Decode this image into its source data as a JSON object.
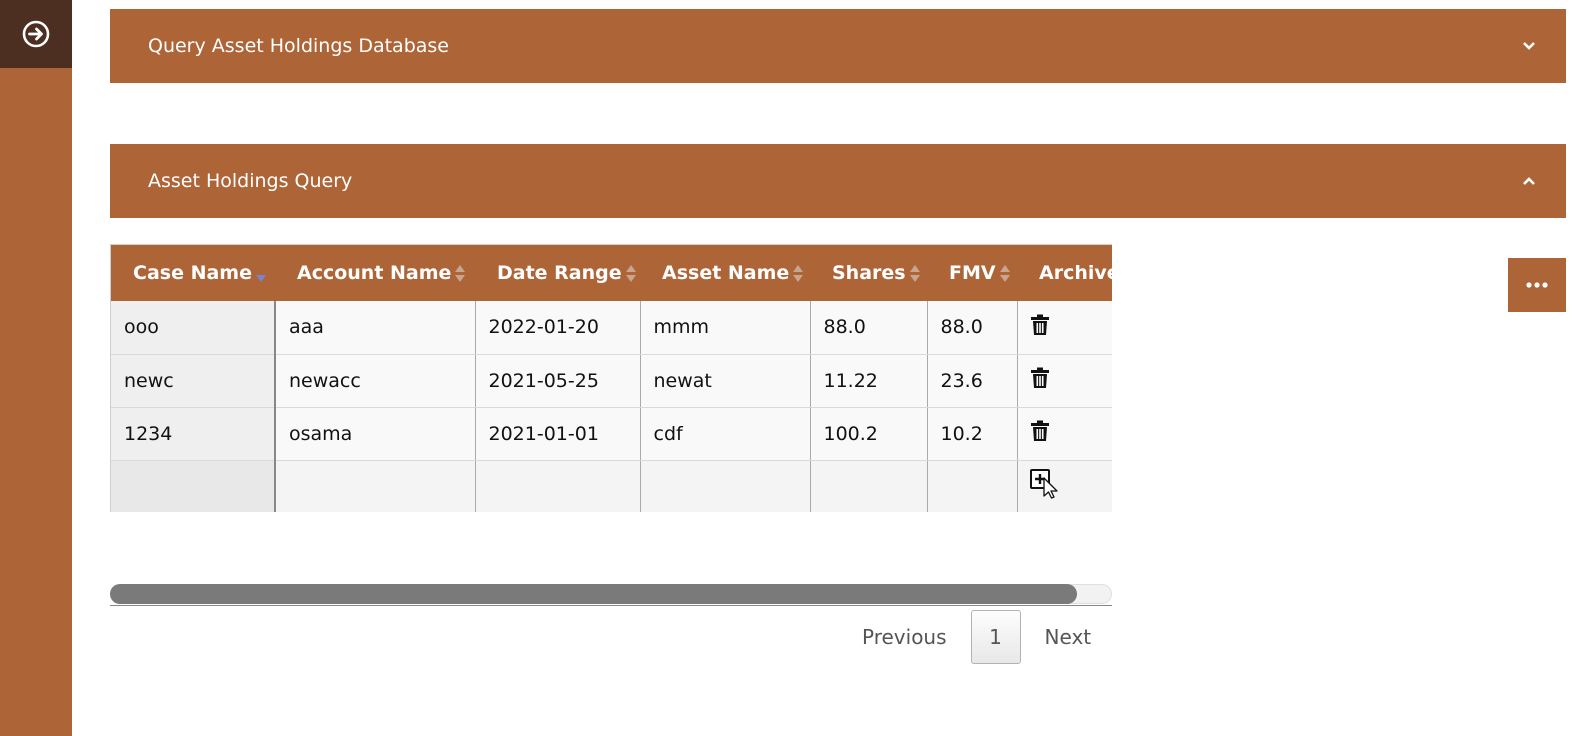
{
  "sidebar": {
    "toggle_icon": "arrow-right-circle-icon"
  },
  "panels": {
    "query_db": {
      "title": "Query Asset Holdings Database",
      "state": "collapsed"
    },
    "holdings_query": {
      "title": "Asset Holdings Query",
      "state": "expanded"
    }
  },
  "table": {
    "headers": [
      "Case Name",
      "Account Name",
      "Date Range",
      "Asset Name",
      "Shares",
      "FMV",
      "Archive"
    ],
    "sorted_column": "Case Name",
    "sort_direction": "descending",
    "rows": [
      [
        "ooo",
        "aaa",
        "2022-01-20",
        "mmm",
        "88.0",
        "88.0"
      ],
      [
        "newc",
        "newacc",
        "2021-05-25",
        "newat",
        "11.22",
        "23.6"
      ],
      [
        "1234",
        "osama",
        "2021-01-01",
        "cdf",
        "100.2",
        "10.2"
      ]
    ]
  },
  "more_button": {
    "icon": "ellipsis-icon"
  },
  "pagination": {
    "previous": "Previous",
    "current_page": "1",
    "next": "Next"
  },
  "colors": {
    "accent": "#ad6538",
    "sidebar_top": "#4d2f22"
  }
}
